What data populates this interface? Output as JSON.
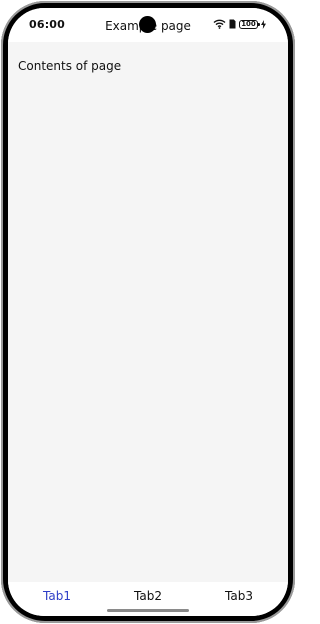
{
  "status_bar": {
    "time": "06:00",
    "battery": "100"
  },
  "header": {
    "title": "Example page"
  },
  "main": {
    "text": "Contents of page"
  },
  "tabs": [
    {
      "label": "Tab1",
      "active": true
    },
    {
      "label": "Tab2",
      "active": false
    },
    {
      "label": "Tab3",
      "active": false
    }
  ],
  "colors": {
    "active_tab": "#2e3ec7",
    "background": "#f5f5f5",
    "frame": "#000000"
  },
  "icons": [
    "wifi-icon",
    "sim-icon",
    "battery-icon",
    "charging-icon"
  ]
}
